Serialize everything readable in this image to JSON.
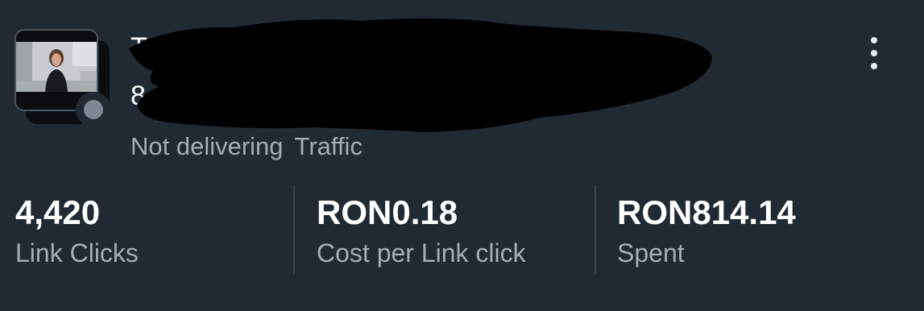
{
  "campaign": {
    "name_visible": "T",
    "id_visible": "8",
    "status": "Not delivering",
    "objective": "Traffic"
  },
  "metrics": [
    {
      "value": "4,420",
      "label": "Link Clicks"
    },
    {
      "value": "RON0.18",
      "label": "Cost per Link click"
    },
    {
      "value": "RON814.14",
      "label": "Spent"
    }
  ],
  "icons": {
    "menu": "more-vertical-icon",
    "status": "status-dot-icon"
  },
  "colors": {
    "background": "#212a33",
    "primary_text": "#ffffff",
    "secondary_text": "#a4adb6",
    "status_dot": "#7d8894",
    "divider": "#3a444e"
  }
}
